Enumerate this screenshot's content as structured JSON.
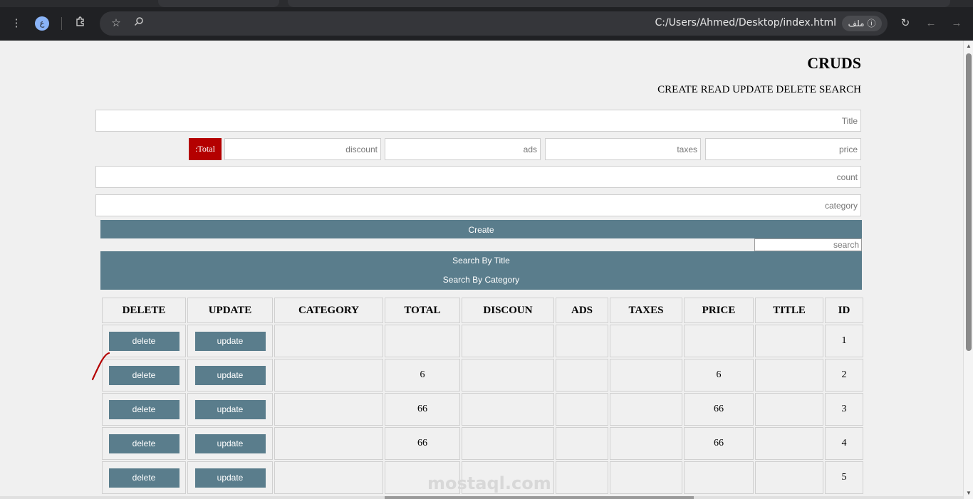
{
  "browser": {
    "url": "C:/Users/Ahmed/Desktop/index.html",
    "site_chip_label": "ملف",
    "profile_initial": "ع"
  },
  "page": {
    "title": "CRUDS",
    "subtitle": "CREATE READ UPDATE DELETE SEARCH"
  },
  "form": {
    "title_placeholder": "Title",
    "price_placeholder": "price",
    "taxes_placeholder": "taxes",
    "ads_placeholder": "ads",
    "discount_placeholder": "discount",
    "total_label": ":Total",
    "count_placeholder": "count",
    "category_placeholder": "category",
    "create_label": "Create"
  },
  "search": {
    "placeholder": "search",
    "by_title_label": "Search By Title",
    "by_category_label": "Search By Category"
  },
  "table": {
    "headers": [
      "DELETE",
      "UPDATE",
      "CATEGORY",
      "TOTAL",
      "DISCOUN",
      "ADS",
      "TAXES",
      "PRICE",
      "TITLE",
      "ID"
    ],
    "delete_label": "delete",
    "update_label": "update",
    "rows": [
      {
        "category": "",
        "total": "",
        "discount": "",
        "ads": "",
        "taxes": "",
        "price": "",
        "title": "",
        "id": "1"
      },
      {
        "category": "",
        "total": "6",
        "discount": "",
        "ads": "",
        "taxes": "",
        "price": "6",
        "title": "",
        "id": "2"
      },
      {
        "category": "",
        "total": "66",
        "discount": "",
        "ads": "",
        "taxes": "",
        "price": "66",
        "title": "",
        "id": "3"
      },
      {
        "category": "",
        "total": "66",
        "discount": "",
        "ads": "",
        "taxes": "",
        "price": "66",
        "title": "",
        "id": "4"
      },
      {
        "category": "",
        "total": "",
        "discount": "",
        "ads": "",
        "taxes": "",
        "price": "",
        "title": "",
        "id": "5"
      }
    ]
  },
  "watermark": "mostaql.com",
  "colors": {
    "accent": "#5a7d8c",
    "total_badge": "#b40000",
    "chrome_bg": "#202124"
  }
}
